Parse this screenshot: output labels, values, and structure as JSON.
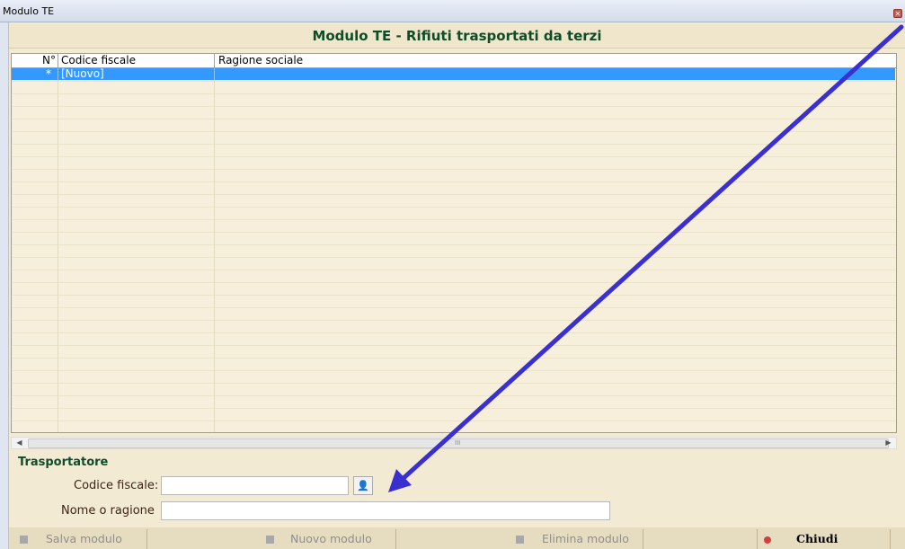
{
  "window": {
    "title": "Modulo TE"
  },
  "header": {
    "title": "Modulo TE - Rifiuti trasportati da terzi"
  },
  "grid": {
    "columns": [
      "N°",
      "Codice fiscale",
      "Ragione sociale"
    ],
    "new_row": {
      "marker": "*",
      "label": "[Nuovo]"
    }
  },
  "section": {
    "title": "Trasportatore"
  },
  "form": {
    "codice_fiscale_label": "Codice fiscale:",
    "codice_fiscale_value": "",
    "nome_label": "Nome o ragione",
    "nome_value": ""
  },
  "scrollbar": {
    "grip": "III"
  },
  "toolbar": {
    "salva": "Salva modulo",
    "nuovo": "Nuovo modulo",
    "elimina": "Elimina modulo",
    "chiudi": "Chiudi"
  },
  "colors": {
    "header_text": "#0d4d2a",
    "selection": "#3399ff",
    "annotation_arrow": "#3a2fd0"
  }
}
